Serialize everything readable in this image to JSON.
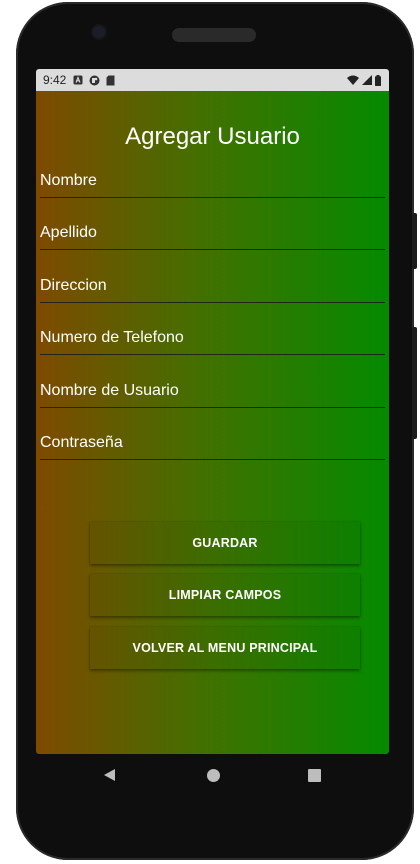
{
  "status_bar": {
    "time": "9:42",
    "left_icons": [
      "notification-a-icon",
      "notification-circle-icon",
      "sd-card-icon"
    ],
    "right_icons": [
      "wifi-icon",
      "signal-icon",
      "battery-icon"
    ]
  },
  "screen": {
    "title": "Agregar Usuario",
    "fields": [
      {
        "label": "Nombre"
      },
      {
        "label": "Apellido"
      },
      {
        "label": "Direccion"
      },
      {
        "label": "Numero de Telefono"
      },
      {
        "label": "Nombre de Usuario"
      },
      {
        "label": "Contraseña"
      }
    ],
    "buttons": {
      "save": "GUARDAR",
      "clear": "LIMPIAR CAMPOS",
      "back": "VOLVER AL MENU PRINCIPAL"
    }
  },
  "colors": {
    "gradient_left": "#7e4a00",
    "gradient_right": "#048a00",
    "status_bar": "#dcdcdc",
    "text": "#ffffff"
  },
  "navigation": {
    "icons": [
      "back-icon",
      "home-icon",
      "recents-icon"
    ]
  }
}
